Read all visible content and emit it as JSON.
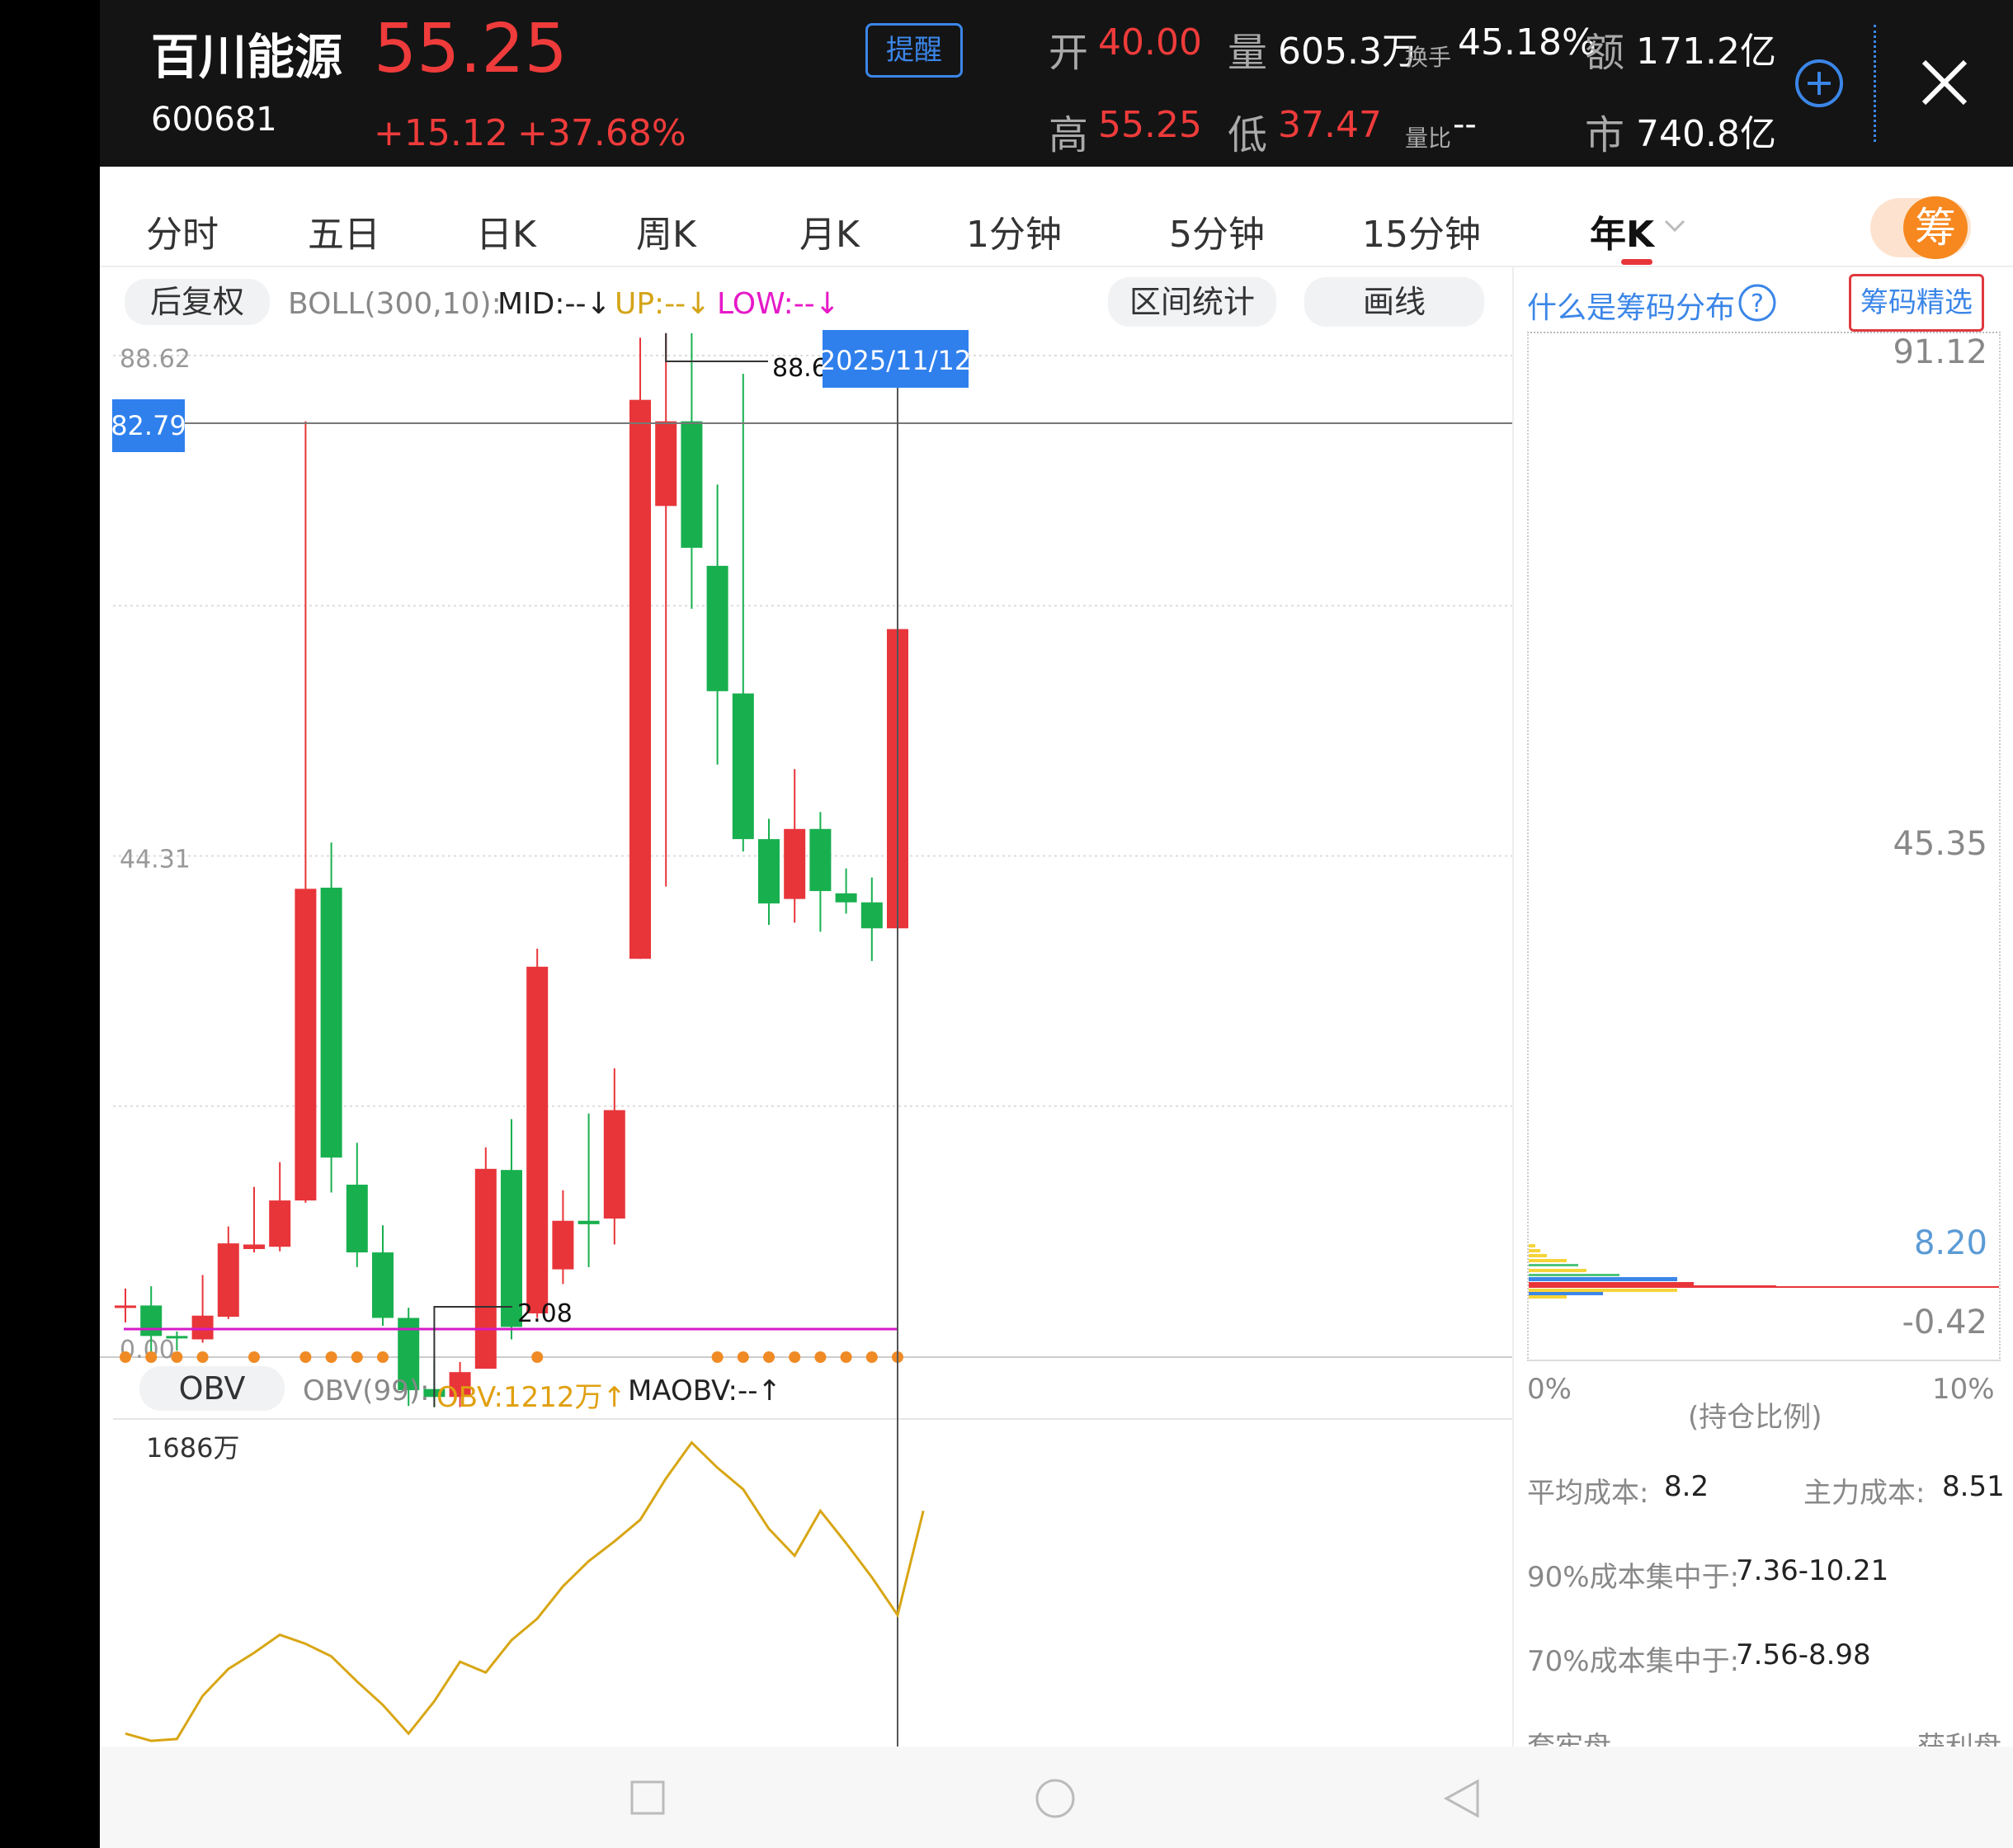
{
  "header": {
    "name": "百川能源",
    "code": "600681",
    "price": "55.25",
    "change": "+15.12",
    "change_pct": "+37.68%",
    "alert_label": "提醒",
    "open_label": "开",
    "open": "40.00",
    "high_label": "高",
    "high": "55.25",
    "low_label": "低",
    "low": "37.47",
    "volume_label": "量",
    "volume": "605.3万",
    "turnover_label": "换手",
    "turnover": "45.18%",
    "amount_label": "额",
    "amount": "171.2亿",
    "ratio_label": "量比",
    "ratio": "--",
    "mktcap_label": "市",
    "mktcap": "740.8亿",
    "add_icon": "plus-circle-icon",
    "close_icon": "close-icon"
  },
  "tabs": [
    "分时",
    "五日",
    "日K",
    "周K",
    "月K",
    "1分钟",
    "5分钟",
    "15分钟",
    "年K"
  ],
  "active_tab": "年K",
  "chip_toggle_label": "筹",
  "indicator": {
    "adjust_label": "后复权",
    "boll_name": "BOLL(300,10):",
    "mid": "MID:--↓",
    "up": "UP:--↓",
    "low": "LOW:--↓",
    "range_stats_label": "区间统计",
    "draw_line_label": "画线"
  },
  "chip_panel": {
    "help_label": "什么是筹码分布",
    "select_label": "筹码精选",
    "top_value": "91.12",
    "mid_value": "45.35",
    "current_value": "8.20",
    "bottom_value": "-0.42",
    "x_min": "0%",
    "x_max": "10%",
    "x_label": "(持仓比例)",
    "avg_cost_label": "平均成本:",
    "avg_cost": "8.2",
    "main_cost_label": "主力成本:",
    "main_cost": "8.51",
    "c90_label": "90%成本集中于:",
    "c90": "7.36-10.21",
    "c70_label": "70%成本集中于:",
    "c70": "7.56-8.98",
    "trapped_label": "套牢盘",
    "profit_label": "获利盘"
  },
  "obv": {
    "button_label": "OBV",
    "name": "OBV(99):",
    "value": "OBV:1212万↑",
    "maobv": "MAOBV:--↑",
    "max_label": "1686万"
  },
  "chart_data": {
    "type": "candlestick",
    "y_axis_labels": [
      "88.62",
      "44.31",
      "0.00"
    ],
    "crosshair_price": "82.79",
    "crosshair_date": "2025/11/12",
    "max_annotation": "88.6",
    "min_annotation": "2.08",
    "ylim": [
      0,
      88.62
    ],
    "candles": [
      {
        "o": 4.5,
        "c": 4.5,
        "h": 6.0,
        "l": 3.0
      },
      {
        "o": 4.5,
        "c": 1.8,
        "h": 6.2,
        "l": -0.2
      },
      {
        "o": 1.8,
        "c": 1.6,
        "h": 2.2,
        "l": 0.5
      },
      {
        "o": 1.5,
        "c": 3.6,
        "h": 7.2,
        "l": 1.2
      },
      {
        "o": 3.5,
        "c": 10.0,
        "h": 11.5,
        "l": 3.3
      },
      {
        "o": 9.5,
        "c": 9.9,
        "h": 15.0,
        "l": 9.2
      },
      {
        "o": 9.7,
        "c": 13.8,
        "h": 17.2,
        "l": 9.3
      },
      {
        "o": 13.8,
        "c": 41.4,
        "h": 82.8,
        "l": 13.6
      },
      {
        "o": 41.5,
        "c": 17.6,
        "h": 45.5,
        "l": 14.5
      },
      {
        "o": 15.2,
        "c": 9.2,
        "h": 18.9,
        "l": 7.9
      },
      {
        "o": 9.2,
        "c": 3.4,
        "h": 11.6,
        "l": 2.7
      },
      {
        "o": 3.4,
        "c": -3.0,
        "h": 4.3,
        "l": -4.4
      },
      {
        "o": -2.9,
        "c": -3.6,
        "h": -0.4,
        "l": -4.5
      },
      {
        "o": -3.6,
        "c": -1.4,
        "h": -0.5,
        "l": -4.5
      },
      {
        "o": -1.1,
        "c": 16.6,
        "h": 18.5,
        "l": -1.1
      },
      {
        "o": 16.5,
        "c": 2.6,
        "h": 21.0,
        "l": 1.5
      },
      {
        "o": 3.8,
        "c": 34.5,
        "h": 36.1,
        "l": 3.4
      },
      {
        "o": 7.7,
        "c": 12.0,
        "h": 14.7,
        "l": 6.4
      },
      {
        "o": 12.0,
        "c": 11.7,
        "h": 21.5,
        "l": 7.9
      },
      {
        "o": 12.2,
        "c": 21.8,
        "h": 25.5,
        "l": 9.9
      },
      {
        "o": 35.2,
        "c": 84.7,
        "h": 90.2,
        "l": 35.2
      },
      {
        "o": 75.3,
        "c": 82.8,
        "h": 90.6,
        "l": 41.6
      },
      {
        "o": 82.8,
        "c": 71.6,
        "h": 90.6,
        "l": 66.2
      },
      {
        "o": 70.0,
        "c": 58.9,
        "h": 77.2,
        "l": 52.4
      },
      {
        "o": 58.7,
        "c": 45.8,
        "h": 87.0,
        "l": 44.7
      },
      {
        "o": 45.8,
        "c": 40.1,
        "h": 47.6,
        "l": 38.2
      },
      {
        "o": 40.5,
        "c": 46.7,
        "h": 52.0,
        "l": 38.4
      },
      {
        "o": 46.7,
        "c": 41.2,
        "h": 48.2,
        "l": 37.6
      },
      {
        "o": 41.0,
        "c": 40.2,
        "h": 43.2,
        "l": 39.2
      },
      {
        "o": 40.2,
        "c": 37.9,
        "h": 42.4,
        "l": 35.0
      },
      {
        "o": 37.9,
        "c": 64.4,
        "h": 64.4,
        "l": 35.0
      }
    ],
    "obv_values": [
      -10,
      -30,
      -25,
      95,
      170,
      215,
      265,
      240,
      205,
      135,
      70,
      -10,
      80,
      190,
      160,
      250,
      310,
      400,
      470,
      525,
      585,
      700,
      800,
      730,
      670,
      560,
      485,
      610,
      520,
      425,
      320,
      610
    ]
  }
}
